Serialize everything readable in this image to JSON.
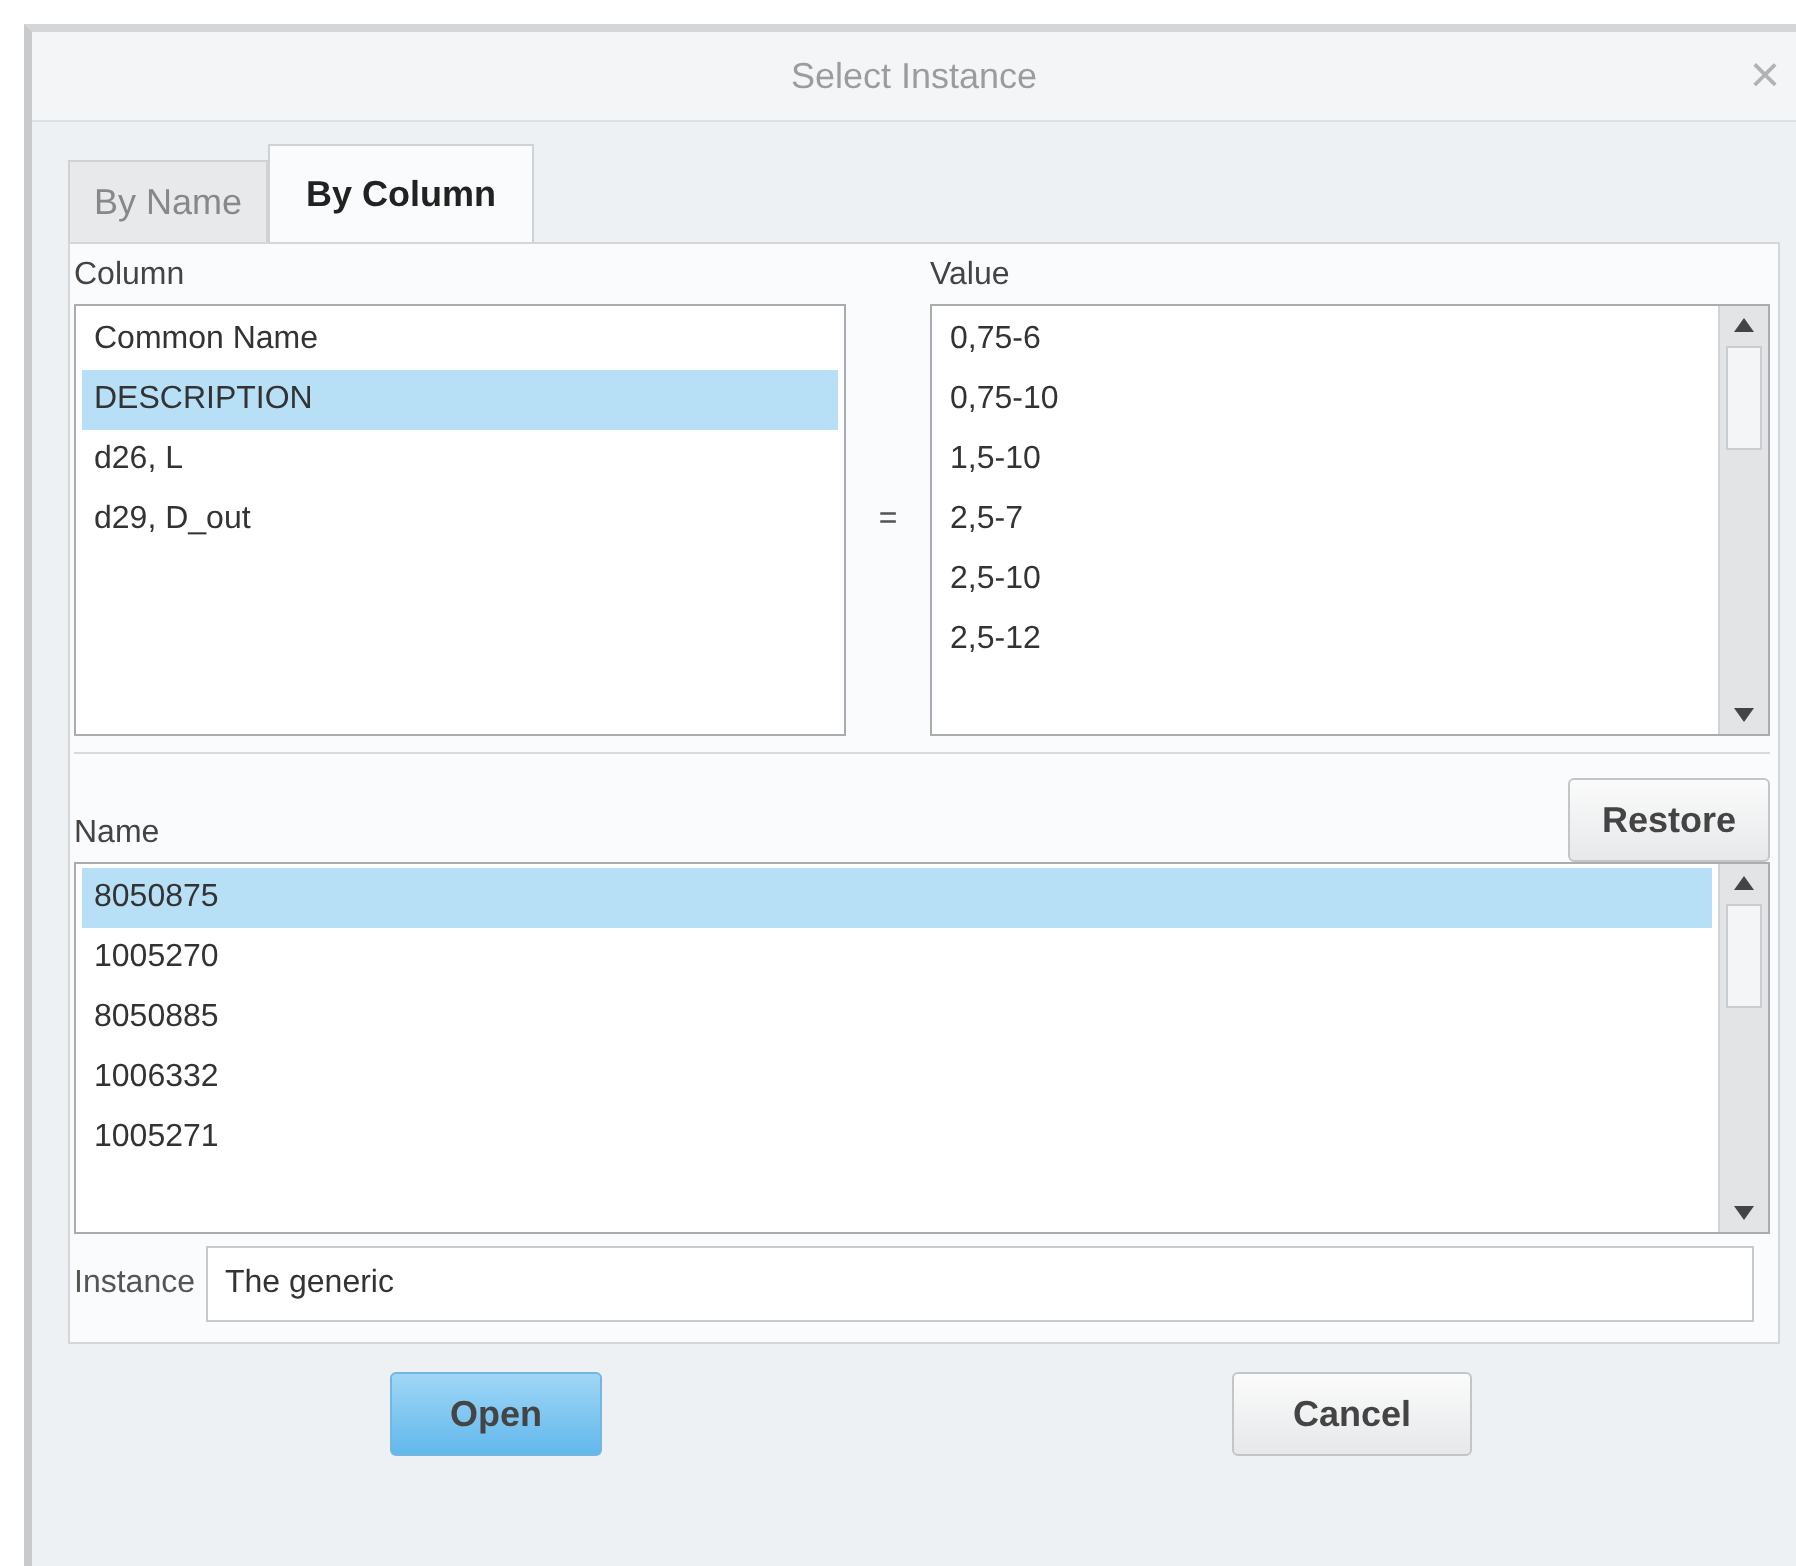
{
  "window": {
    "title": "Select Instance",
    "close": "×"
  },
  "tabs": [
    {
      "label": "By Name",
      "selected": false
    },
    {
      "label": "By Column",
      "selected": true
    }
  ],
  "column_list": {
    "label": "Column",
    "items": [
      {
        "text": "Common Name",
        "selected": false
      },
      {
        "text": "DESCRIPTION",
        "selected": true
      },
      {
        "text": "d26, L",
        "selected": false
      },
      {
        "text": "d29, D_out",
        "selected": false
      }
    ]
  },
  "operator": "=",
  "value_list": {
    "label": "Value",
    "items": [
      {
        "text": "0,75-6",
        "selected": false
      },
      {
        "text": "0,75-10",
        "selected": false
      },
      {
        "text": "1,5-10",
        "selected": false
      },
      {
        "text": "2,5-7",
        "selected": false
      },
      {
        "text": "2,5-10",
        "selected": false
      },
      {
        "text": "2,5-12",
        "selected": false
      }
    ]
  },
  "restore_button": "Restore",
  "name_list": {
    "label": "Name",
    "items": [
      {
        "text": "8050875",
        "selected": true
      },
      {
        "text": "1005270",
        "selected": false
      },
      {
        "text": "8050885",
        "selected": false
      },
      {
        "text": "1006332",
        "selected": false
      },
      {
        "text": "1005271",
        "selected": false
      }
    ]
  },
  "instance": {
    "label": "Instance",
    "value": "The generic"
  },
  "buttons": [
    {
      "label": "Open",
      "kind": "primary"
    },
    {
      "label": "Cancel",
      "kind": "normal"
    }
  ]
}
